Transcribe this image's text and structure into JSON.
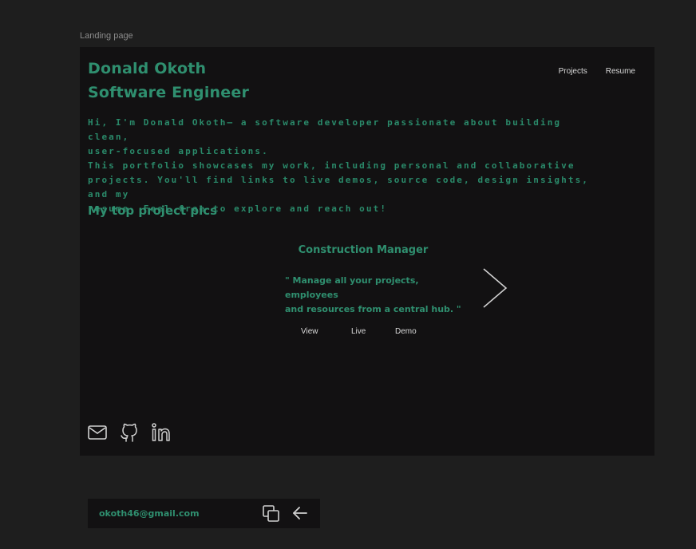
{
  "canvas": {
    "frame_label": "Landing page"
  },
  "header": {
    "name": "Donald Okoth",
    "role": "Software Engineer",
    "nav": {
      "projects": "Projects",
      "resume": "Resume"
    }
  },
  "intro": {
    "text": "Hi, I'm Donald Okoth— a software developer passionate about building clean,\nuser-focused applications.\nThis portfolio showcases my work, including personal and collaborative\nprojects. You'll find links to live demos, source code, design insights, and my\nresume. Feel free to explore and reach out!"
  },
  "projects": {
    "section_title": "My top project pics",
    "current": {
      "title": "Construction Manager",
      "description_line1": "\" Manage all your projects, employees",
      "description_line2": "and resources from a central hub. \"",
      "links": {
        "view": "View",
        "live": "Live",
        "demo": "Demo"
      }
    },
    "next_icon": "chevron-right-icon"
  },
  "socials": [
    "mail-icon",
    "github-icon",
    "linkedin-icon"
  ],
  "email_bar": {
    "email": "okoth46@gmail.com",
    "icons": [
      "copy-icon",
      "arrow-left-icon"
    ]
  },
  "colors": {
    "accent": "#2f8f6f",
    "background": "#1e1e1e",
    "frame": "#121112",
    "nav_text": "#d9d9d9"
  }
}
